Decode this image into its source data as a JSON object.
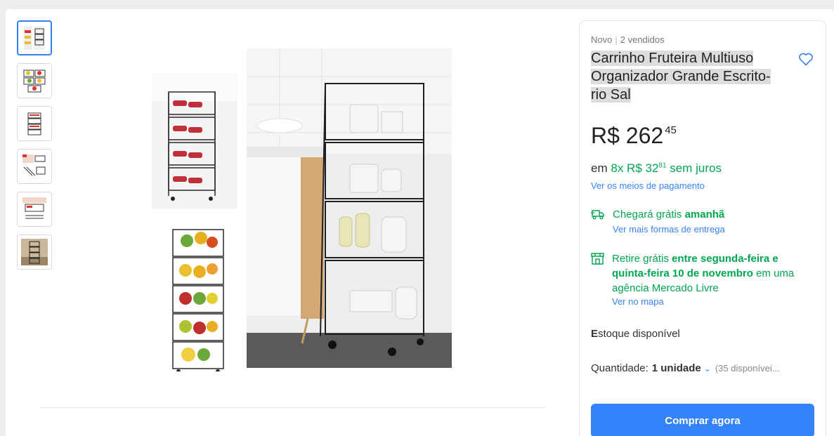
{
  "product": {
    "condition": "Novo",
    "sold": "2 vendidos",
    "title_lines": [
      "Carrinho Fruteira Multiuso",
      "Organizador Grande Escrito-",
      "rio Sal"
    ],
    "price_int": "R$ 262",
    "price_cents": "45",
    "installments_prefix": "em",
    "installments_text": "8x R$ 32",
    "installments_cents": "81",
    "installments_suffix": "sem juros",
    "payment_link": "Ver os meios de pagamento"
  },
  "shipping": {
    "text": "Chegará grátis",
    "bold": "amanhã",
    "link": "Ver mais formas de entrega"
  },
  "pickup": {
    "pre": "Retire grátis",
    "b1": "entre segunda-feira e quinta-feira",
    "mid": "10",
    "b2": "de novembro",
    "post": "em uma agência Mercado Livre",
    "link": "Ver no mapa"
  },
  "stock": {
    "first": "E",
    "rest": "stoque disponível"
  },
  "quantity": {
    "label": "Quantidade:",
    "value": "1 unidade",
    "available": "(35 disponívei..."
  },
  "buy_button": "Comprar agora",
  "thumbnails": [
    "thumb-1",
    "thumb-2",
    "thumb-3",
    "thumb-4",
    "thumb-5",
    "thumb-6"
  ],
  "colors": {
    "accent": "#3483fa",
    "green": "#00a650"
  },
  "icons": {
    "favorite": "heart-icon",
    "shipping": "truck-icon",
    "pickup": "store-icon",
    "quantity": "chevron-down-icon"
  }
}
